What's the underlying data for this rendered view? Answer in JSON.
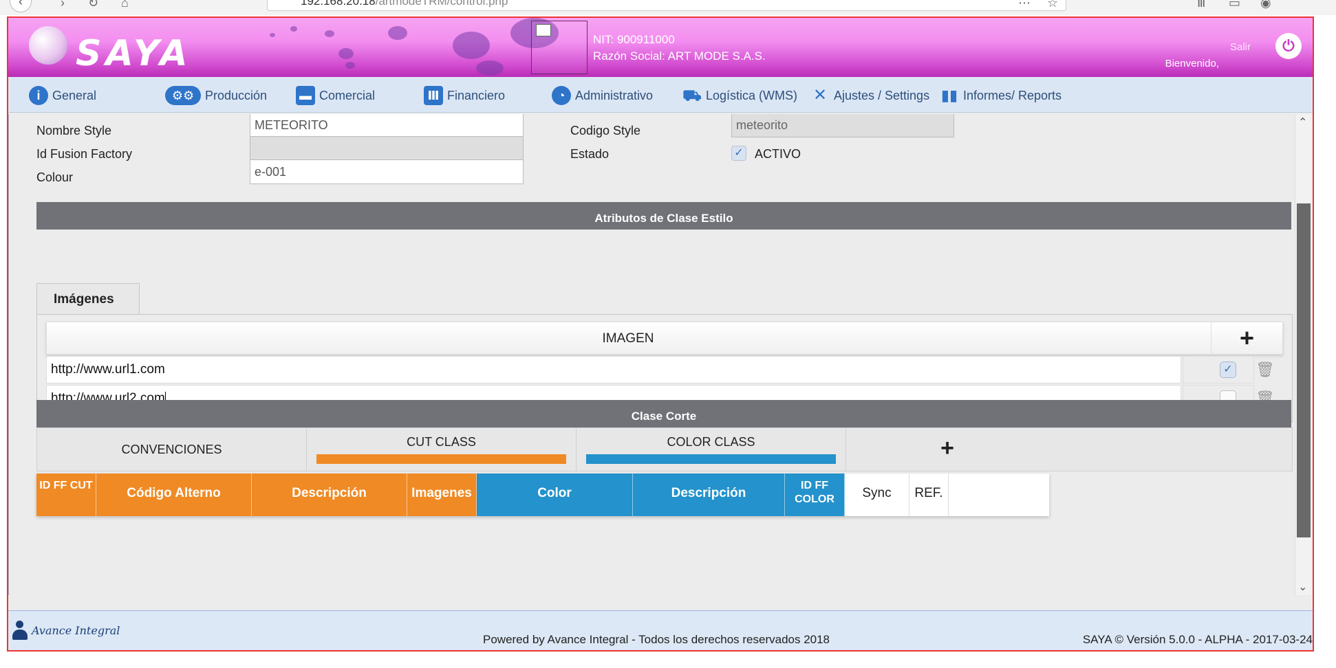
{
  "browser": {
    "url_main": "192.168.20.18",
    "url_path": "/artmodeTRM/control.php"
  },
  "header": {
    "logo_text": "SAYA",
    "nit": "NIT: 900911000",
    "razon_social": "Razón Social: ART MODE S.A.S.",
    "salir_label": "Salir",
    "bienvenido_label": "Bienvenido,"
  },
  "menu": {
    "items": [
      {
        "label": "General",
        "icon": "info-icon"
      },
      {
        "label": "Producción",
        "icon": "gears-icon"
      },
      {
        "label": "Comercial",
        "icon": "briefcase-icon"
      },
      {
        "label": "Financiero",
        "icon": "bank-icon"
      },
      {
        "label": "Administrativo",
        "icon": "pie-chart-icon"
      },
      {
        "label": "Logística (WMS)",
        "icon": "hand-truck-icon"
      },
      {
        "label": "Ajustes / Settings",
        "icon": "wrench-icon"
      },
      {
        "label": "Informes/ Reports",
        "icon": "bar-chart-icon"
      }
    ]
  },
  "form": {
    "nombre_style_label": "Nombre Style",
    "nombre_style_value": "METEORITO",
    "codigo_style_label": "Codigo Style",
    "codigo_style_value": "meteorito",
    "id_fusion_label": "Id Fusion Factory",
    "id_fusion_value": "",
    "estado_label": "Estado",
    "estado_checked": true,
    "estado_value": "ACTIVO",
    "colour_label": "Colour",
    "colour_value": "e-001"
  },
  "atributos": {
    "section_title": "Atributos de Clase Estilo",
    "tab_label": "Imágenes",
    "table_header": "IMAGEN",
    "add_symbol": "+",
    "rows": [
      {
        "url": "http://www.url1.com",
        "checked": true
      },
      {
        "url": "http://www.url2.com",
        "checked": false
      }
    ]
  },
  "clase_corte": {
    "section_title": "Clase Corte",
    "convenciones_label": "CONVENCIONES",
    "cut_class_label": "CUT CLASS",
    "color_class_label": "COLOR CLASS",
    "add_symbol": "+",
    "colors": {
      "cut": "#f08a24",
      "color": "#2492cc"
    },
    "columns": {
      "id_ff_cut": "ID FF CUT",
      "codigo_alterno": "Código Alterno",
      "descripcion_cut": "Descripción",
      "imagenes": "Imagenes",
      "color": "Color",
      "descripcion_color": "Descripción",
      "id_ff_color_1": "ID FF",
      "id_ff_color_2": "COLOR",
      "sync": "Sync",
      "ref": "REF."
    }
  },
  "footer": {
    "logo_text": "Avance Integral",
    "center_text": "Powered by Avance Integral - Todos los derechos reservados 2018",
    "right_text": "SAYA © Versión 5.0.0 - ALPHA - 2017-03-24"
  }
}
